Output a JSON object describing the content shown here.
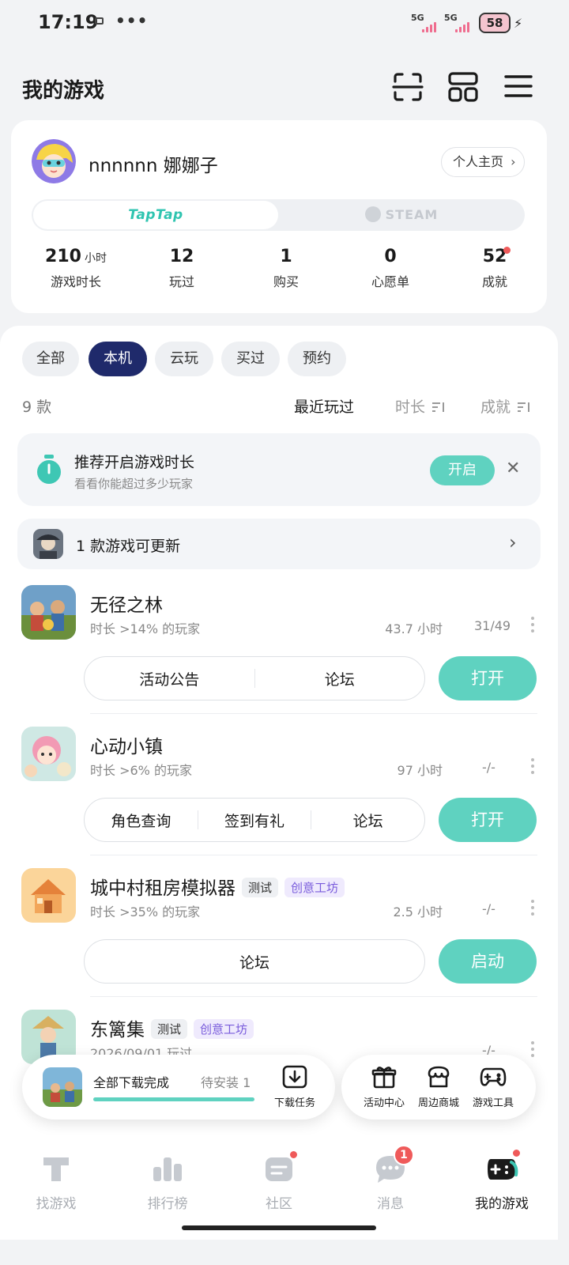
{
  "status_bar": {
    "time": "17:19",
    "dots": "•••",
    "signal1_label": "5G",
    "signal2_label": "5G",
    "battery": "58",
    "accent_color": "#ef6c8e"
  },
  "header": {
    "title": "我的游戏",
    "icons": [
      "scan-icon",
      "grid-icon",
      "menu-icon"
    ]
  },
  "profile": {
    "username": "nnnnnn 娜娜子",
    "homepage_label": "个人主页",
    "platforms": {
      "taptap": "TapTap",
      "steam": "STEAM",
      "selected": "TapTap"
    },
    "stats": [
      {
        "value": "210",
        "unit": "小时",
        "label": "游戏时长"
      },
      {
        "value": "12",
        "unit": "",
        "label": "玩过"
      },
      {
        "value": "1",
        "unit": "",
        "label": "购买"
      },
      {
        "value": "0",
        "unit": "",
        "label": "心愿单"
      },
      {
        "value": "52",
        "unit": "",
        "label": "成就"
      }
    ]
  },
  "filters": {
    "items": [
      "全部",
      "本机",
      "云玩",
      "买过",
      "预约"
    ],
    "selected": "本机"
  },
  "list_header": {
    "count": "9 款",
    "sort_recent": "最近玩过",
    "sort_duration": "时长",
    "sort_achievement": "成就"
  },
  "tip": {
    "title": "推荐开启游戏时长",
    "subtitle": "看看你能超过多少玩家",
    "action": "开启",
    "close": "✕"
  },
  "update": {
    "text": "1 款游戏可更新"
  },
  "games": [
    {
      "name": "无径之林",
      "tags": [],
      "meta": "时长 >14% 的玩家",
      "hours": "43.7 小时",
      "achievements": "31/49",
      "actions": [
        "活动公告",
        "论坛"
      ],
      "primary": "打开"
    },
    {
      "name": "心动小镇",
      "tags": [],
      "meta": "时长 >6% 的玩家",
      "hours": "97 小时",
      "achievements": "-/-",
      "actions": [
        "角色查询",
        "签到有礼",
        "论坛"
      ],
      "primary": "打开"
    },
    {
      "name": "城中村租房模拟器",
      "tags": [
        "测试",
        "创意工坊"
      ],
      "meta": "时长 >35% 的玩家",
      "hours": "2.5 小时",
      "achievements": "-/-",
      "actions": [
        "论坛"
      ],
      "primary": "启动"
    },
    {
      "name": "东篱集",
      "tags": [
        "测试",
        "创意工坊"
      ],
      "meta": "2026/09/01 玩过",
      "hours": "",
      "achievements": "-/-"
    }
  ],
  "download_panel": {
    "title": "全部下载完成",
    "pending": "待安装 1",
    "progress": 1.0,
    "task_label": "下载任务"
  },
  "tools": [
    {
      "icon": "gift-icon",
      "label": "活动中心"
    },
    {
      "icon": "shop-icon",
      "label": "周边商城"
    },
    {
      "icon": "gamepad-icon",
      "label": "游戏工具"
    }
  ],
  "tabbar": {
    "items": [
      {
        "icon": "taptap-icon",
        "label": "找游戏"
      },
      {
        "icon": "ranking-icon",
        "label": "排行榜"
      },
      {
        "icon": "community-icon",
        "label": "社区"
      },
      {
        "icon": "message-icon",
        "label": "消息",
        "badge": "1"
      },
      {
        "icon": "my-games-icon",
        "label": "我的游戏"
      }
    ],
    "selected": "我的游戏"
  }
}
